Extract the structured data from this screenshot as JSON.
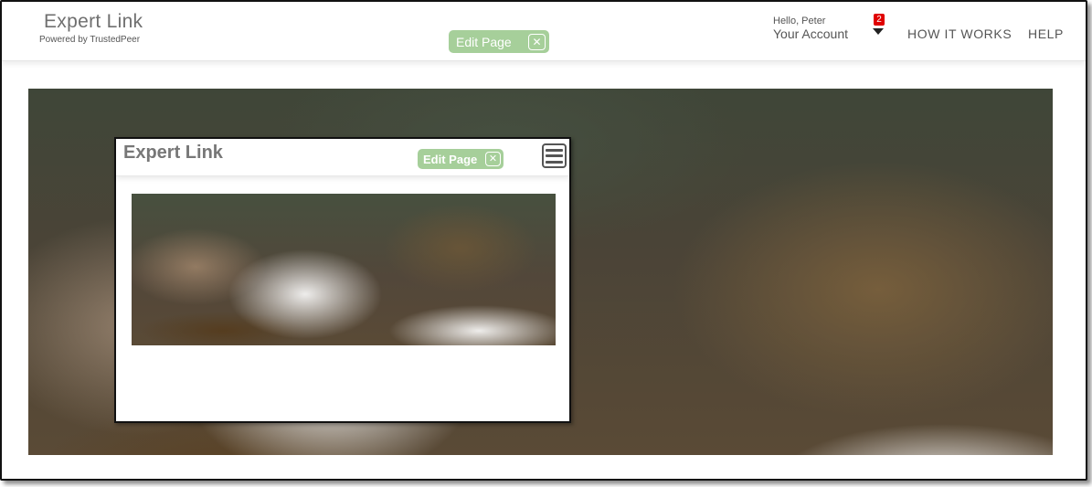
{
  "header": {
    "brand_title": "Expert Link",
    "brand_subtitle": "Powered by TrustedPeer",
    "edit_page_label": "Edit Page",
    "close_glyph": "✕",
    "greeting": "Hello, Peter",
    "account_label": "Your Account",
    "notification_count": "2",
    "nav": {
      "how_it_works": "HOW IT WORKS",
      "help": "HELP"
    }
  },
  "hero": {
    "image": "rushing-water-over-rocks"
  },
  "preview_window": {
    "title": "Expert Link",
    "edit_page_label": "Edit Page",
    "close_glyph": "✕",
    "menu_icon": "hamburger-menu-icon",
    "image": "rushing-water-over-rocks"
  },
  "colors": {
    "edit_button_bg": "#a6cf9a",
    "badge_bg": "#e00000",
    "text_gray": "#555555"
  }
}
